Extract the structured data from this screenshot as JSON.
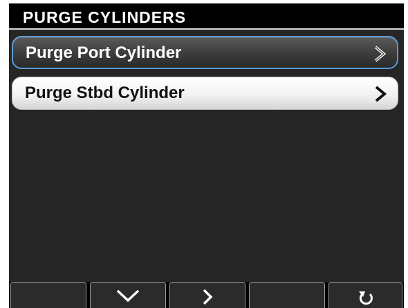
{
  "screen": {
    "title": "PURGE CYLINDERS"
  },
  "menu": {
    "items": [
      {
        "label": "Purge Port Cylinder",
        "selected": true,
        "icon": "chevron-right-icon"
      },
      {
        "label": "Purge Stbd Cylinder",
        "selected": false,
        "icon": "chevron-right-icon"
      }
    ]
  },
  "softkeys": [
    {
      "icon": ""
    },
    {
      "icon": "chevron-down-icon"
    },
    {
      "icon": "chevron-right-icon"
    },
    {
      "icon": ""
    },
    {
      "icon": "back-arrow-icon"
    }
  ],
  "colors": {
    "background": "#262626",
    "title_bar": "#000000",
    "selection_border": "#5c9bd8",
    "item_normal": "#f2f2f2",
    "text_light": "#ffffff",
    "text_dark": "#111111"
  }
}
